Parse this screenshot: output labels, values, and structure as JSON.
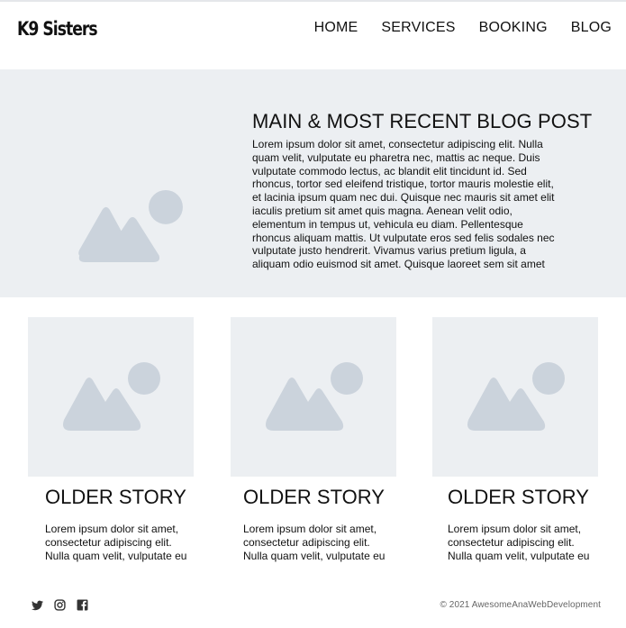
{
  "header": {
    "logo": "K9 Sisters",
    "nav": [
      {
        "label": "HOME"
      },
      {
        "label": "SERVICES"
      },
      {
        "label": "BOOKING"
      },
      {
        "label": "BLOG"
      }
    ]
  },
  "hero": {
    "title": "MAIN & MOST RECENT BLOG POST",
    "body": "Lorem ipsum dolor sit amet, consectetur adipiscing elit. Nulla quam velit, vulputate eu pharetra nec, mattis ac neque. Duis vulputate commodo lectus, ac blandit elit tincidunt id. Sed rhoncus, tortor sed eleifend tristique, tortor mauris molestie elit, et lacinia ipsum quam nec dui. Quisque nec mauris sit amet elit iaculis pretium sit amet quis magna. Aenean velit odio, elementum in tempus ut, vehicula eu diam. Pellentesque rhoncus aliquam mattis. Ut vulputate eros sed felis sodales nec vulputate justo hendrerit. Vivamus varius pretium ligula, a aliquam odio euismod sit amet. Quisque laoreet sem sit amet orci ullamcorper",
    "image_icon": "image-placeholder-icon"
  },
  "stories": [
    {
      "title": "OLDER STORY",
      "body": "Lorem ipsum dolor sit amet, consectetur adipiscing elit. Nulla quam velit, vulputate eu"
    },
    {
      "title": "OLDER STORY",
      "body": "Lorem ipsum dolor sit amet, consectetur adipiscing elit. Nulla quam velit, vulputate eu"
    },
    {
      "title": "OLDER STORY",
      "body": "Lorem ipsum dolor sit amet, consectetur adipiscing elit. Nulla quam velit, vulputate eu"
    }
  ],
  "footer": {
    "social": [
      "twitter-icon",
      "instagram-icon",
      "facebook-icon"
    ],
    "copyright": "© 2021 AwesomeAnaWebDevelopment"
  },
  "colors": {
    "placeholder_bg": "#eceff2",
    "placeholder_icon": "#cbd3dc",
    "text": "#111111",
    "footer_text": "#666666"
  }
}
